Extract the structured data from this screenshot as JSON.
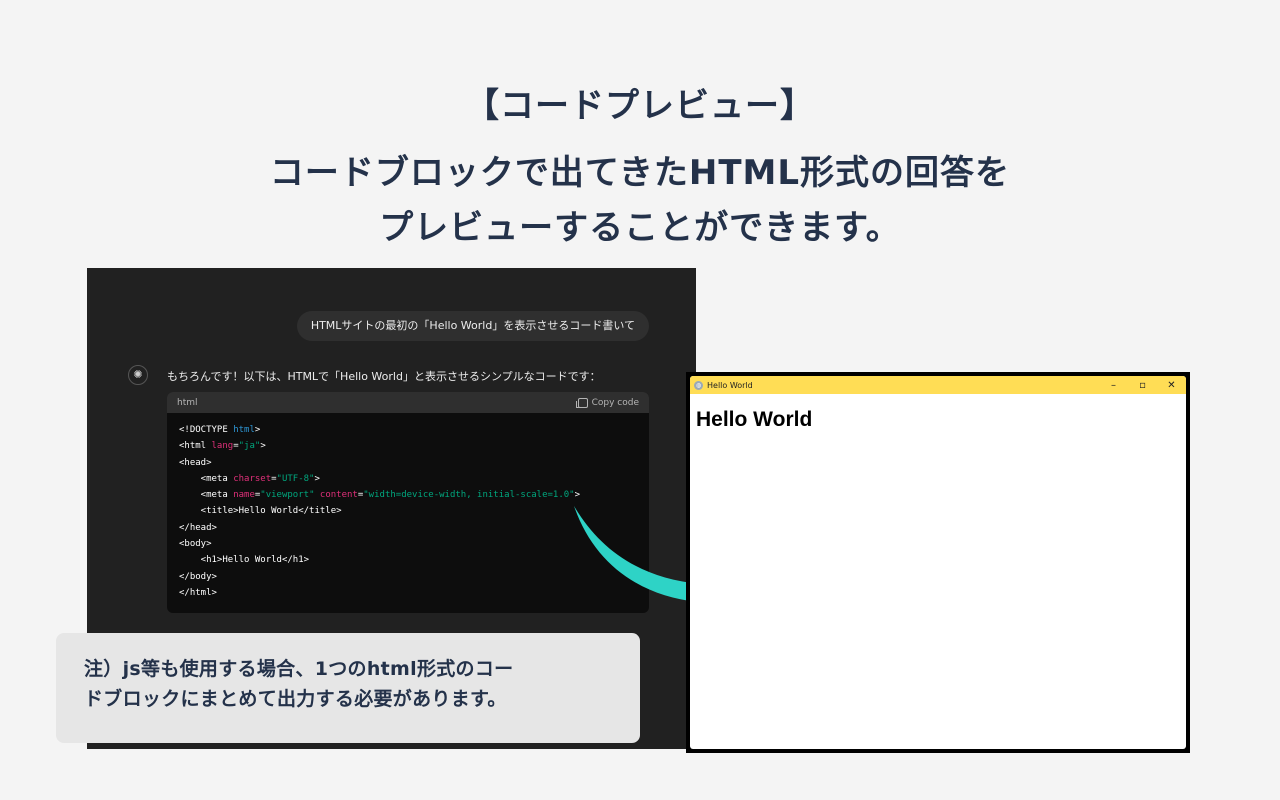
{
  "headline": {
    "line1": "【コードプレビュー】",
    "line2": "コードブロックで出てきたHTML形式の回答を",
    "line3": "プレビューすることができます。"
  },
  "chat": {
    "user_message": "HTMLサイトの最初の「Hello World」を表示させるコード書いて",
    "assistant_icon": "openai-logo-icon",
    "assistant_text": "もちろんです！以下は、HTMLで「Hello World」と表示させるシンプルなコードです：",
    "code_block": {
      "language": "html",
      "copy_label": "Copy code",
      "lines": [
        "<!DOCTYPE html>",
        "<html lang=\"ja\">",
        "<head>",
        "    <meta charset=\"UTF-8\">",
        "    <meta name=\"viewport\" content=\"width=device-width, initial-scale=1.0\">",
        "    <title>Hello World</title>",
        "</head>",
        "<body>",
        "    <h1>Hello World</h1>",
        "</body>",
        "</html>"
      ]
    }
  },
  "note": {
    "line1": "注）js等も使用する場合、1つのhtml形式のコー",
    "line2": "ドブロックにまとめて出力する必要があります。"
  },
  "preview_window": {
    "title": "Hello World",
    "minimize": "–",
    "maximize": "▫",
    "close": "✕",
    "content_heading": "Hello World",
    "titlebar_color": "#ffdd55"
  },
  "colors": {
    "accent_arrow": "#2ed3c6",
    "heading_text": "#24324a",
    "chat_bg": "#212121"
  }
}
